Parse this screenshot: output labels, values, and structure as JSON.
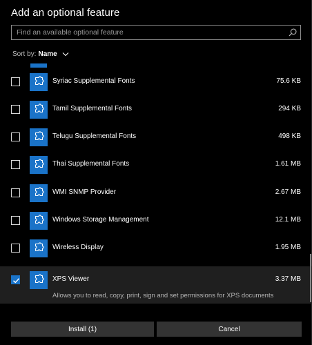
{
  "dialog": {
    "title": "Add an optional feature"
  },
  "search": {
    "placeholder": "Find an available optional feature",
    "value": ""
  },
  "sort": {
    "label": "Sort by:",
    "value": "Name"
  },
  "features": [
    {
      "name": "Syriac Supplemental Fonts",
      "size": "75.6 KB",
      "checked": false,
      "selected": false
    },
    {
      "name": "Tamil Supplemental Fonts",
      "size": "294 KB",
      "checked": false,
      "selected": false
    },
    {
      "name": "Telugu Supplemental Fonts",
      "size": "498 KB",
      "checked": false,
      "selected": false
    },
    {
      "name": "Thai Supplemental Fonts",
      "size": "1.61 MB",
      "checked": false,
      "selected": false
    },
    {
      "name": "WMI SNMP Provider",
      "size": "2.67 MB",
      "checked": false,
      "selected": false
    },
    {
      "name": "Windows Storage Management",
      "size": "12.1 MB",
      "checked": false,
      "selected": false
    },
    {
      "name": "Wireless Display",
      "size": "1.95 MB",
      "checked": false,
      "selected": false
    },
    {
      "name": "XPS Viewer",
      "size": "3.37 MB",
      "checked": true,
      "selected": true,
      "description": "Allows you to read, copy, print, sign and set permissions for XPS documents"
    }
  ],
  "footer": {
    "install_label": "Install (1)",
    "cancel_label": "Cancel"
  },
  "colors": {
    "accent": "#1a73c8",
    "background": "#000000",
    "selected_row": "#1f1f1f",
    "button": "#333333"
  },
  "icons": {
    "feature": "puzzle-piece-icon",
    "search": "search-icon",
    "sort": "chevron-down-icon",
    "check": "checkmark-icon"
  }
}
